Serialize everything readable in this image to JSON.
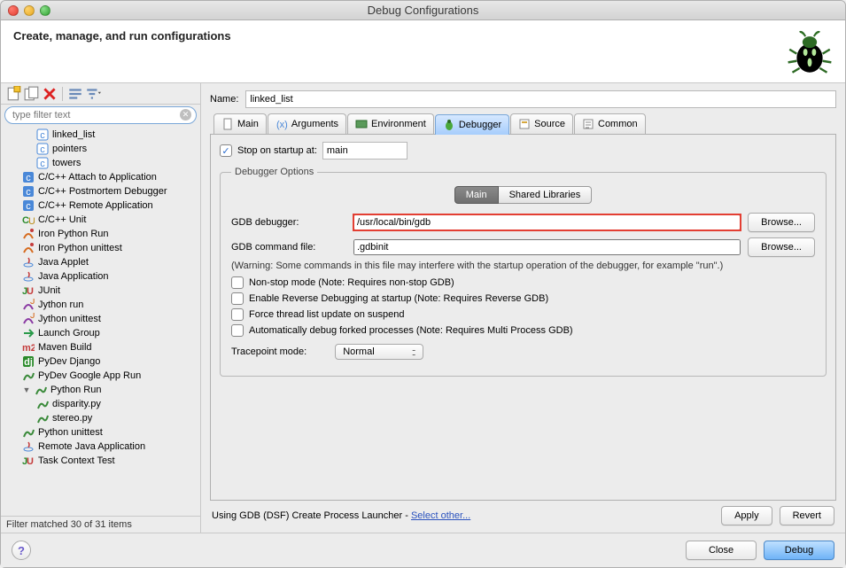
{
  "window": {
    "title": "Debug Configurations"
  },
  "header": {
    "title": "Create, manage, and run configurations"
  },
  "filter": {
    "placeholder": "type filter text"
  },
  "tree": {
    "items": [
      {
        "label": "linked_list",
        "indent": 2,
        "icon": "c-icon"
      },
      {
        "label": "pointers",
        "indent": 2,
        "icon": "c-icon"
      },
      {
        "label": "towers",
        "indent": 2,
        "icon": "c-icon"
      },
      {
        "label": "C/C++ Attach to Application",
        "indent": 1,
        "icon": "c-box-icon"
      },
      {
        "label": "C/C++ Postmortem Debugger",
        "indent": 1,
        "icon": "c-box-icon"
      },
      {
        "label": "C/C++ Remote Application",
        "indent": 1,
        "icon": "c-box-icon"
      },
      {
        "label": "C/C++ Unit",
        "indent": 1,
        "icon": "cu-icon"
      },
      {
        "label": "Iron Python Run",
        "indent": 1,
        "icon": "iron-icon"
      },
      {
        "label": "Iron Python unittest",
        "indent": 1,
        "icon": "iron-icon"
      },
      {
        "label": "Java Applet",
        "indent": 1,
        "icon": "java-icon"
      },
      {
        "label": "Java Application",
        "indent": 1,
        "icon": "java-icon"
      },
      {
        "label": "JUnit",
        "indent": 1,
        "icon": "junit-icon"
      },
      {
        "label": "Jython run",
        "indent": 1,
        "icon": "jython-icon"
      },
      {
        "label": "Jython unittest",
        "indent": 1,
        "icon": "jython-icon"
      },
      {
        "label": "Launch Group",
        "indent": 1,
        "icon": "launch-icon"
      },
      {
        "label": "Maven Build",
        "indent": 1,
        "icon": "m2-icon"
      },
      {
        "label": "PyDev Django",
        "indent": 1,
        "icon": "dj-icon"
      },
      {
        "label": "PyDev Google App Run",
        "indent": 1,
        "icon": "py-icon"
      },
      {
        "label": "Python Run",
        "indent": 1,
        "icon": "py-icon",
        "expanded": true
      },
      {
        "label": "disparity.py",
        "indent": 2,
        "icon": "py-icon"
      },
      {
        "label": "stereo.py",
        "indent": 2,
        "icon": "py-icon"
      },
      {
        "label": "Python unittest",
        "indent": 1,
        "icon": "py-icon"
      },
      {
        "label": "Remote Java Application",
        "indent": 1,
        "icon": "java-icon"
      },
      {
        "label": "Task Context Test",
        "indent": 1,
        "icon": "junit-icon"
      }
    ],
    "footer": "Filter matched 30 of 31 items"
  },
  "name": {
    "label": "Name:",
    "value": "linked_list"
  },
  "tabs": {
    "items": [
      {
        "label": "Main",
        "icon": "doc-icon"
      },
      {
        "label": "Arguments",
        "icon": "args-icon"
      },
      {
        "label": "Environment",
        "icon": "env-icon"
      },
      {
        "label": "Debugger",
        "icon": "bug-icon",
        "active": true
      },
      {
        "label": "Source",
        "icon": "source-icon"
      },
      {
        "label": "Common",
        "icon": "common-icon"
      }
    ]
  },
  "debugger": {
    "stop_label": "Stop on startup at:",
    "stop_value": "main",
    "options_legend": "Debugger Options",
    "subtabs": [
      "Main",
      "Shared Libraries"
    ],
    "gdb_label": "GDB debugger:",
    "gdb_value": "/usr/local/bin/gdb",
    "browse": "Browse...",
    "cmdfile_label": "GDB command file:",
    "cmdfile_value": ".gdbinit",
    "warning": "(Warning: Some commands in this file may interfere with the startup operation of the debugger, for example \"run\".)",
    "opt_nonstop": "Non-stop mode (Note: Requires non-stop GDB)",
    "opt_reverse": "Enable Reverse Debugging at startup (Note: Requires Reverse GDB)",
    "opt_force": "Force thread list update on suspend",
    "opt_autofork": "Automatically debug forked processes (Note: Requires Multi Process GDB)",
    "trace_label": "Tracepoint mode:",
    "trace_value": "Normal"
  },
  "launcher": {
    "text": "Using GDB (DSF) Create Process Launcher - ",
    "link": "Select other..."
  },
  "buttons": {
    "apply": "Apply",
    "revert": "Revert",
    "close": "Close",
    "debug": "Debug"
  }
}
